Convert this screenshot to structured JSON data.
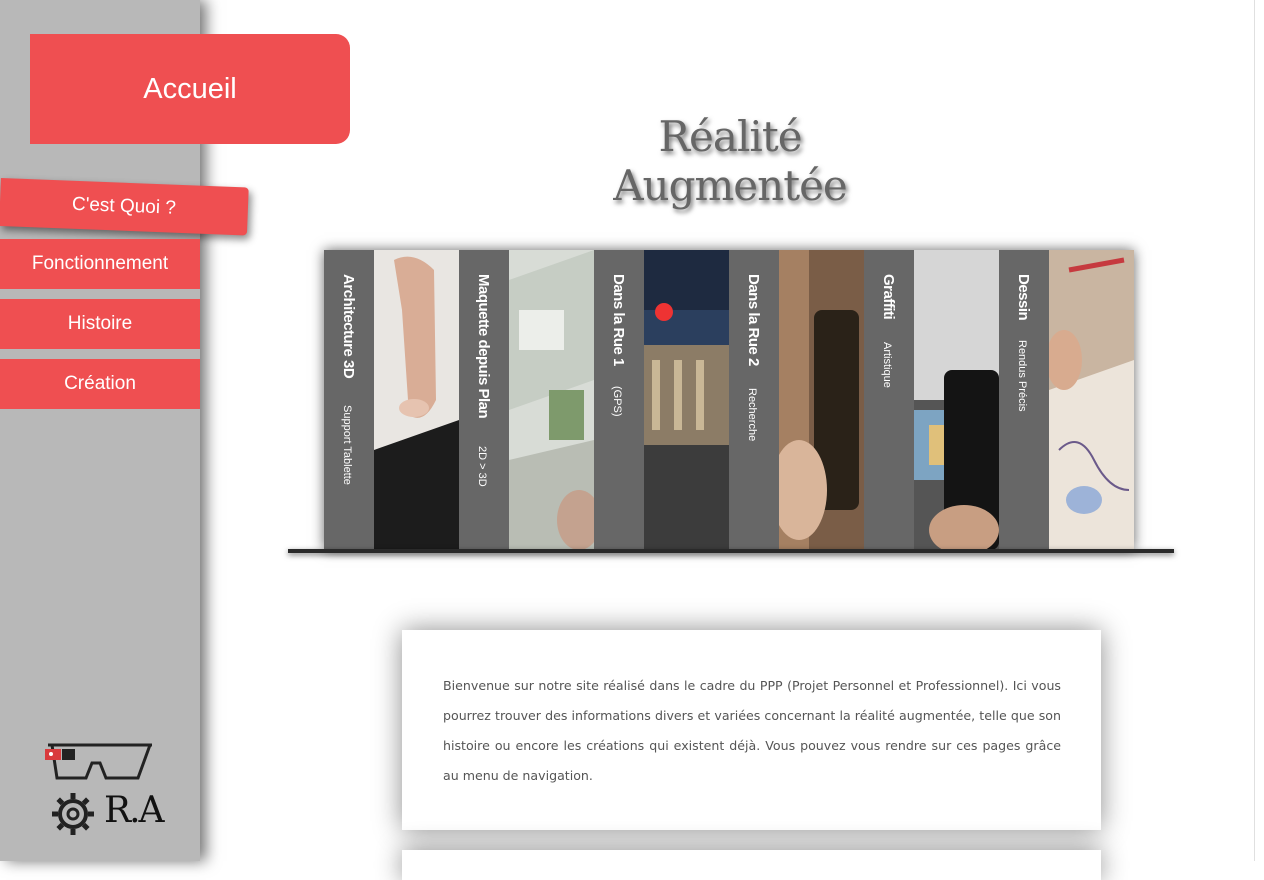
{
  "nav": {
    "home": "Accueil",
    "items": [
      "C'est Quoi ?",
      "Fonctionnement",
      "Histoire",
      "Création"
    ]
  },
  "logo": {
    "text": "R.A",
    "icons": [
      "glasses-icon",
      "gear-icon"
    ]
  },
  "page": {
    "title": "Réalité Augmentée"
  },
  "slides": [
    {
      "title": "Architecture 3D",
      "subtitle": "Support Tablette"
    },
    {
      "title": "Maquette depuis Plan",
      "subtitle": "2D > 3D"
    },
    {
      "title": "Dans la Rue 1",
      "subtitle": "(GPS)"
    },
    {
      "title": "Dans la Rue 2",
      "subtitle": "Recherche"
    },
    {
      "title": "Graffiti",
      "subtitle": "Artistique"
    },
    {
      "title": "Dessin",
      "subtitle": "Rendus Précis"
    }
  ],
  "intro": {
    "text": "Bienvenue sur notre site réalisé dans le cadre du PPP (Projet Personnel et Professionnel). Ici vous pourrez trouver des informations divers et variées concernant la réalité augmentée, telle que son histoire ou encore les créations qui existent déjà. Vous pouvez vous rendre sur ces pages grâce au menu de navigation."
  },
  "colors": {
    "accent": "#ef4f51",
    "sidebar": "#b8b8b8"
  }
}
